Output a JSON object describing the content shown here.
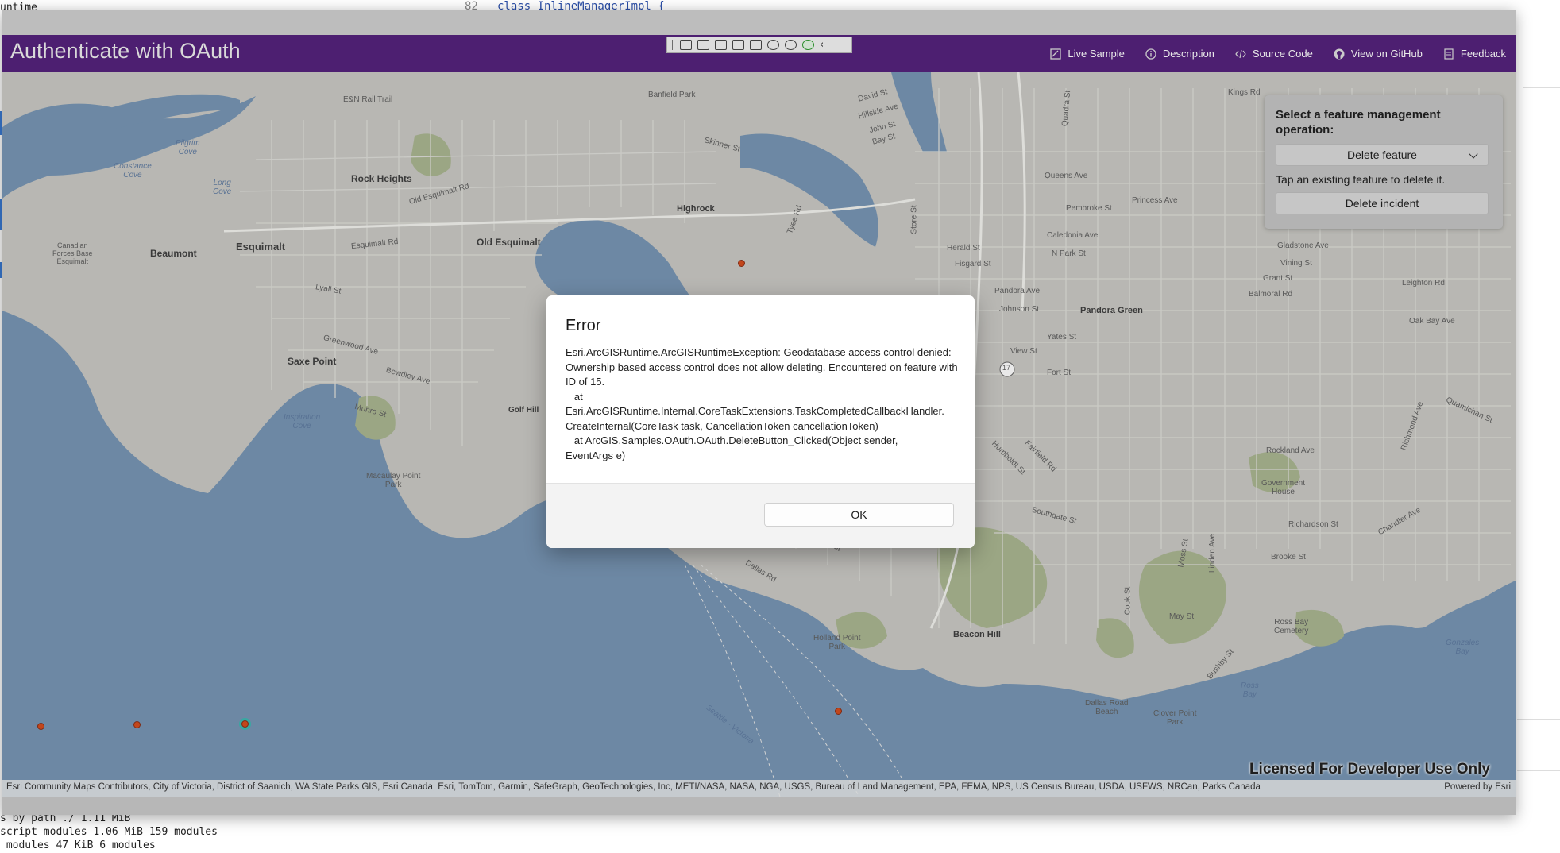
{
  "background": {
    "terminal_lines": [
      "untime",
      "s by path ./ 1.11 MiB",
      "script modules 1.06 MiB 159 modules",
      " modules 47 KiB 6 modules"
    ],
    "code_line_number": "82",
    "code_line_text": "class InlineManagerImpl {"
  },
  "header": {
    "title": "Authenticate with OAuth",
    "nav": [
      {
        "label": "Live Sample",
        "icon": "live-sample-icon"
      },
      {
        "label": "Description",
        "icon": "info-icon"
      },
      {
        "label": "Source Code",
        "icon": "code-icon"
      },
      {
        "label": "View on GitHub",
        "icon": "github-icon"
      },
      {
        "label": "Feedback",
        "icon": "feedback-icon"
      }
    ]
  },
  "panel": {
    "title": "Select a feature management operation:",
    "selected_operation": "Delete feature",
    "hint": "Tap an existing feature to delete it.",
    "button_label": "Delete incident"
  },
  "dialog": {
    "title": "Error",
    "message": "Esri.ArcGISRuntime.ArcGISRuntimeException: Geodatabase access control denied: Ownership based access control does not allow deleting. Encountered on feature with ID of 15.\n   at\nEsri.ArcGISRuntime.Internal.CoreTaskExtensions.TaskCompletedCallbackHandler.\nCreateInternal(CoreTask task, CancellationToken cancellationToken)\n   at ArcGIS.Samples.OAuth.OAuth.DeleteButton_Clicked(Object sender,\nEventArgs e)",
    "ok_label": "OK"
  },
  "map": {
    "licensed_text": "Licensed For Developer Use Only",
    "attribution": "Esri Community Maps Contributors, City of Victoria, District of Saanich, WA State Parks GIS, Esri Canada, Esri, TomTom, Garmin, SafeGraph, GeoTechnologies, Inc, METI/NASA, NASA, NGA, USGS, Bureau of Land Management, EPA, FEMA, NPS, US Census Bureau, USDA, USFWS, NRCan, Parks Canada",
    "powered_by": "Powered by Esri",
    "labels": {
      "esquimalt": "Esquimalt",
      "beaumont": "Beaumont",
      "rock_heights": "Rock Heights",
      "old_esquimalt": "Old Esquimalt",
      "highrock": "Highrock",
      "saxe_point": "Saxe Point",
      "golf_hill": "Golf Hill",
      "cfb": "Canadian\nForces Base\nEsquimalt",
      "pilgrim_cove": "Pilgrim\nCove",
      "constance_cove": "Constance\nCove",
      "long_cove": "Long\nCove",
      "inspiration_cove": "Inspiration\nCove",
      "macaulay_park": "Macaulay Point\nPark",
      "pandora_green": "Pandora Green",
      "beacon_hill": "Beacon Hill",
      "holland_point_park": "Holland Point\nPark",
      "dallas_road_beach": "Dallas Road\nBeach",
      "clover_point_park": "Clover Point\nPark",
      "ross_bay_cemetery": "Ross Bay\nCemetery",
      "ross_bay": "Ross\nBay",
      "government_house": "Government\nHouse",
      "gonzales_bay": "Gonzales\nBay",
      "seattle_victoria": "Seattle - Victoria",
      "en_rail_trail": "E&N Rail Trail",
      "banfield_park": "Banfield Park",
      "david_st": "David St",
      "hillside_ave": "Hillside Ave",
      "john_st": "John St",
      "bay_st": "Bay St",
      "kings_rd": "Kings Rd",
      "queens_ave": "Queens Ave",
      "princess_ave": "Princess Ave",
      "pembroke_st": "Pembroke St",
      "caledonia_ave": "Caledonia Ave",
      "n_park_st": "N Park St",
      "herald_st": "Herald St",
      "fisgard_st": "Fisgard St",
      "pandora_ave": "Pandora Ave",
      "johnson_st": "Johnson St",
      "yates_st": "Yates St",
      "view_st": "View St",
      "fort_st": "Fort St",
      "grant_st": "Grant St",
      "balmoral_rd": "Balmoral Rd",
      "gladstone_ave": "Gladstone Ave",
      "vining_st": "Vining St",
      "leighton_rd": "Leighton Rd",
      "oak_bay_ave": "Oak Bay Ave",
      "rockland_ave": "Rockland Ave",
      "richardson_st": "Richardson St",
      "brooke_st": "Brooke St",
      "may_st": "May St",
      "dallas_rd": "Dallas Rd",
      "niagara_st": "Niagara St",
      "southgate_st": "Southgate St",
      "fairfield_rd": "Fairfield Rd",
      "humboldt_st": "Humboldt St",
      "esquimalt_rd": "Esquimalt Rd",
      "old_esquimalt_rd": "Old Esquimalt Rd",
      "lyall_st": "Lyall St",
      "greenwood_ave": "Greenwood Ave",
      "bewdley_ave": "Bewdley Ave",
      "munro_st": "Munro St",
      "skinner_st": "Skinner St",
      "tyee_rd": "Tyee Rd",
      "store_st": "Store St",
      "quadra_st": "Quadra St",
      "cook_st": "Cook St",
      "linden_ave": "Linden Ave",
      "moss_st": "Moss St",
      "chandler_ave": "Chandler Ave",
      "quamichan_st": "Quamichan St",
      "richmond_ave": "Richmond Ave",
      "bushby_st": "Bushby St",
      "highway_17": "17"
    }
  },
  "colors": {
    "header_purple": "#521f7a",
    "water": "#7594b3",
    "land": "#c9c8c3",
    "park": "#a9b58f",
    "feature_dot": "#d44a1a"
  }
}
